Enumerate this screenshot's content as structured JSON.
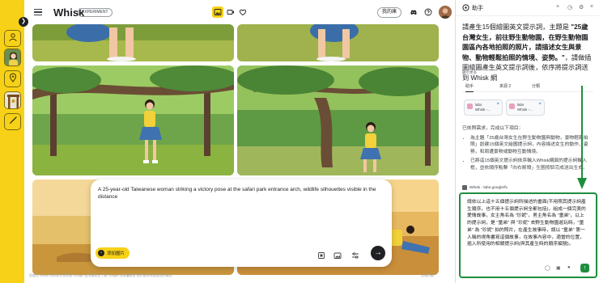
{
  "app": {
    "name": "Whisk",
    "badge": "EXPERIMENT",
    "library_button": "我的庫",
    "footer_left": "您使用 Whisk 時即表示您同意 Google 使用條款並了解 Google 隱私權政策 我們會如何處理您的資料",
    "footer_right": "回報活動",
    "accent": "#f7d117"
  },
  "rail": {
    "items": [
      "person-icon",
      "portrait-thumb",
      "location-icon",
      "scene-thumb",
      "brush-icon"
    ]
  },
  "prompt": {
    "text": "A 25-year-old Taiwanese woman striking a victory pose at the safari park entrance arch, wildlife silhouettes visible in the distance",
    "add_images_label": "添加圖片"
  },
  "assistant": {
    "title": "助手",
    "message_prefix": "請產生15個繪圖英文提示詞，主題是 ",
    "message_bold": "\"25歲台灣女生，前往野生動物園，在野生動物園園區內各地拍照的照片，請描述女生與景物、動物輕鬆拍照的情境、姿勢。\"",
    "message_suffix": "，請做插圖繪圖產生英文提示詞後，依序將提示詞送到 Whisk 網",
    "small_note": "顯示更多",
    "tabs": [
      "助手",
      "來源 2",
      "分類"
    ],
    "sources": [
      {
        "title": "labs",
        "subtitle": "Whisk -..."
      },
      {
        "title": "labs",
        "subtitle": "Whisk -..."
      }
    ],
    "status_line": "已依照需求，完成以下項目：",
    "bullets": [
      "為主題「25歲台灣女生在野生動物園與動物，景物輕鬆拍照」創建15個英文繪圖提示詞，內容描述女生的動作、姿勢，和周遭景物或動物互動情境。",
      "已將這15個英文提示詞依序輸入Whisk網頁的提示詞輸入框，並依順序點擊「向右箭頭」生圖按鈕完成送出生成。"
    ],
    "chip": "Whisk - labs.google/fx",
    "composer_text": "請依以上這十五個提示詞所描述的畫面(不用照其提示詞產生順序，也不用十五個提示詞全都包括)，組成一個完美的愛情故事，女主角名為 \"珍妮\"，男主角名為 \"童弟\"，以上的提示詞，是 \"童弟\" 與 \"珍妮\" 去野生動物園遊玩時，\"童弟\" 為 \"珍妮\" 拍的照片，在產生故事時，請以 \"童弟\" 第一人稱的視角書寫這個故事，在故事內容中，適當的位置，插入所使用的相關提示詞(與其產生時的順序編號)。",
    "arrow_color": "#1e8e3e"
  }
}
